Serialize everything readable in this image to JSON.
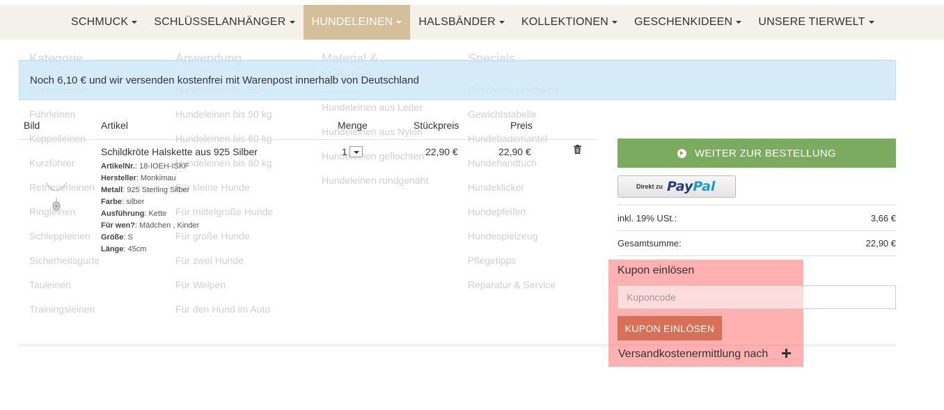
{
  "nav": {
    "items": [
      {
        "label": "SCHMUCK"
      },
      {
        "label": "SCHLÜSSELANHÄNGER"
      },
      {
        "label": "HUNDELEINEN"
      },
      {
        "label": "HALSBÄNDER"
      },
      {
        "label": "KOLLEKTIONEN"
      },
      {
        "label": "GESCHENKIDEEN"
      },
      {
        "label": "UNSERE TIERWELT"
      }
    ],
    "active_index": 2
  },
  "mega_menu": {
    "columns": [
      {
        "title": "Kategorie",
        "items": [
          "Doppelleinen",
          "Führleinen",
          "Koppelleinen",
          "Kurzführer",
          "Retrieverleinen",
          "Ringleinen",
          "Schleppleinen",
          "Sicherheitsgurte",
          "Tauleinen",
          "Trainingsleinen"
        ]
      },
      {
        "title": "Anwendung",
        "items": [
          "Hundeleinen bis 30 kg",
          "Hundeleinen bis 50 kg",
          "Hundeleinen bis 60 kg",
          "Hundeleinen bis 80 kg",
          "Für kleine Hunde",
          "Für mittelgroße Hunde",
          "Für große Hunde",
          "Für zwei Hunde",
          "Für Welpen",
          "Für den Hund im Auto"
        ]
      },
      {
        "title": "Material & Verarbeitung",
        "items": [
          "Hundeleinen aus Leder",
          "Hundeleinen aus Nylon",
          "Hundeleinen geflochten",
          "Hundeleinen rundgenäht"
        ]
      },
      {
        "title": "Specials",
        "items": [
          "Geschenkgutscheine",
          "Gewichtstabelle",
          "Hundebademantel",
          "Hundehandtuch",
          "Hundeklicker",
          "Hundepfeifen",
          "Hundespielzeug",
          "Pflegetipps",
          "Reparatur & Service"
        ]
      }
    ]
  },
  "notice": {
    "text": "Noch 6,10 € und wir versenden kostenfrei mit Warenpost innerhalb von Deutschland"
  },
  "cart": {
    "headers": {
      "image": "Bild",
      "article": "Artikel",
      "quantity": "Menge",
      "unit_price": "Stückpreis",
      "price": "Preis"
    },
    "item": {
      "title": "Schildkröte Halskette aus 925 Silber",
      "details": [
        {
          "label": "ArtikelNr.",
          "sep": ": ",
          "value": "18-IOEH-ISKF"
        },
        {
          "label": "Hersteller",
          "sep": ": ",
          "value": "Monkimau"
        },
        {
          "label": "Metall",
          "sep": ": ",
          "value": "925 Sterling Silber"
        },
        {
          "label": "Farbe",
          "sep": ": ",
          "value": "silber"
        },
        {
          "label": "Ausführung",
          "sep": ": ",
          "value": "Kette"
        },
        {
          "label": "Für wen?",
          "sep": ": ",
          "value": "Mädchen , Kinder"
        },
        {
          "label": "Größe",
          "sep": ": ",
          "value": "S"
        },
        {
          "label": "Länge",
          "sep": ": ",
          "value": "45cm"
        }
      ],
      "quantity": "1",
      "unit_price": "22,90 €",
      "price": "22,90 €",
      "image_icon": "necklace-thumbnail",
      "delete_icon": "trash-icon"
    }
  },
  "summary": {
    "order_button": "WEITER ZUR BESTELLUNG",
    "paypal": {
      "prefix": "Direkt zu",
      "brand_a": "Pay",
      "brand_b": "Pal"
    },
    "tax_label": "inkl. 19% USt.:",
    "tax_value": "3,66 €",
    "total_label": "Gesamtsumme:",
    "total_value": "22,90 €"
  },
  "coupon": {
    "heading": "Kupon einlösen",
    "placeholder": "Kuponcode",
    "button": "KUPON EINLÖSEN"
  },
  "shipping": {
    "label": "Versandkostenermittlung nach"
  },
  "colors": {
    "nav_bg": "#f4f1ea",
    "nav_active": "#d5bf9b",
    "notice_bg": "#cde6f6",
    "order_button": "#7aab5e",
    "coupon_button": "#d87058",
    "highlight": "#ff7878"
  }
}
